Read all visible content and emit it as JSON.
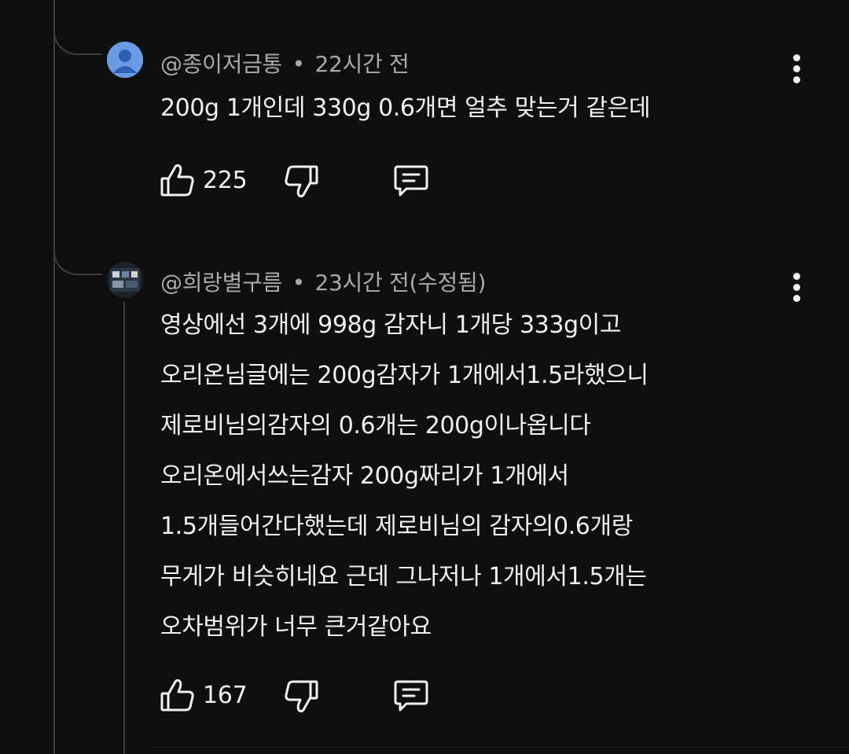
{
  "comments": [
    {
      "author": "@종이저금통",
      "time": "22시간 전",
      "lines": [
        "200g 1개인데 330g 0.6개면 얼추 맞는거 같은데"
      ],
      "likes": "225",
      "avatar": "default-person-avatar"
    },
    {
      "author": "@희랑별구름",
      "time": "23시간 전(수정됨)",
      "lines": [
        "영상에선 3개에 998g 감자니 1개당 333g이고",
        "오리온님글에는 200g감자가 1개에서1.5라했으니",
        "제로비님의감자의 0.6개는 200g이나옵니다",
        "오리온에서쓰는감자 200g짜리가 1개에서",
        "1.5개들어간다했는데 제로비님의 감자의0.6개랑",
        "무게가 비슷히네요 근데 그나저나 1개에서1.5개는",
        "오차범위가 너무 큰거같아요"
      ],
      "likes": "167",
      "avatar": "photo-avatar"
    }
  ],
  "separator": "•",
  "icons": {
    "like": "thumbs-up-icon",
    "dislike": "thumbs-down-icon",
    "reply": "reply-comment-icon",
    "more": "more-vertical-icon"
  },
  "colors": {
    "background": "#0f0f0f",
    "text": "#f1f1f1",
    "meta": "#aaaaaa",
    "thread_line": "#3d3d3d"
  }
}
